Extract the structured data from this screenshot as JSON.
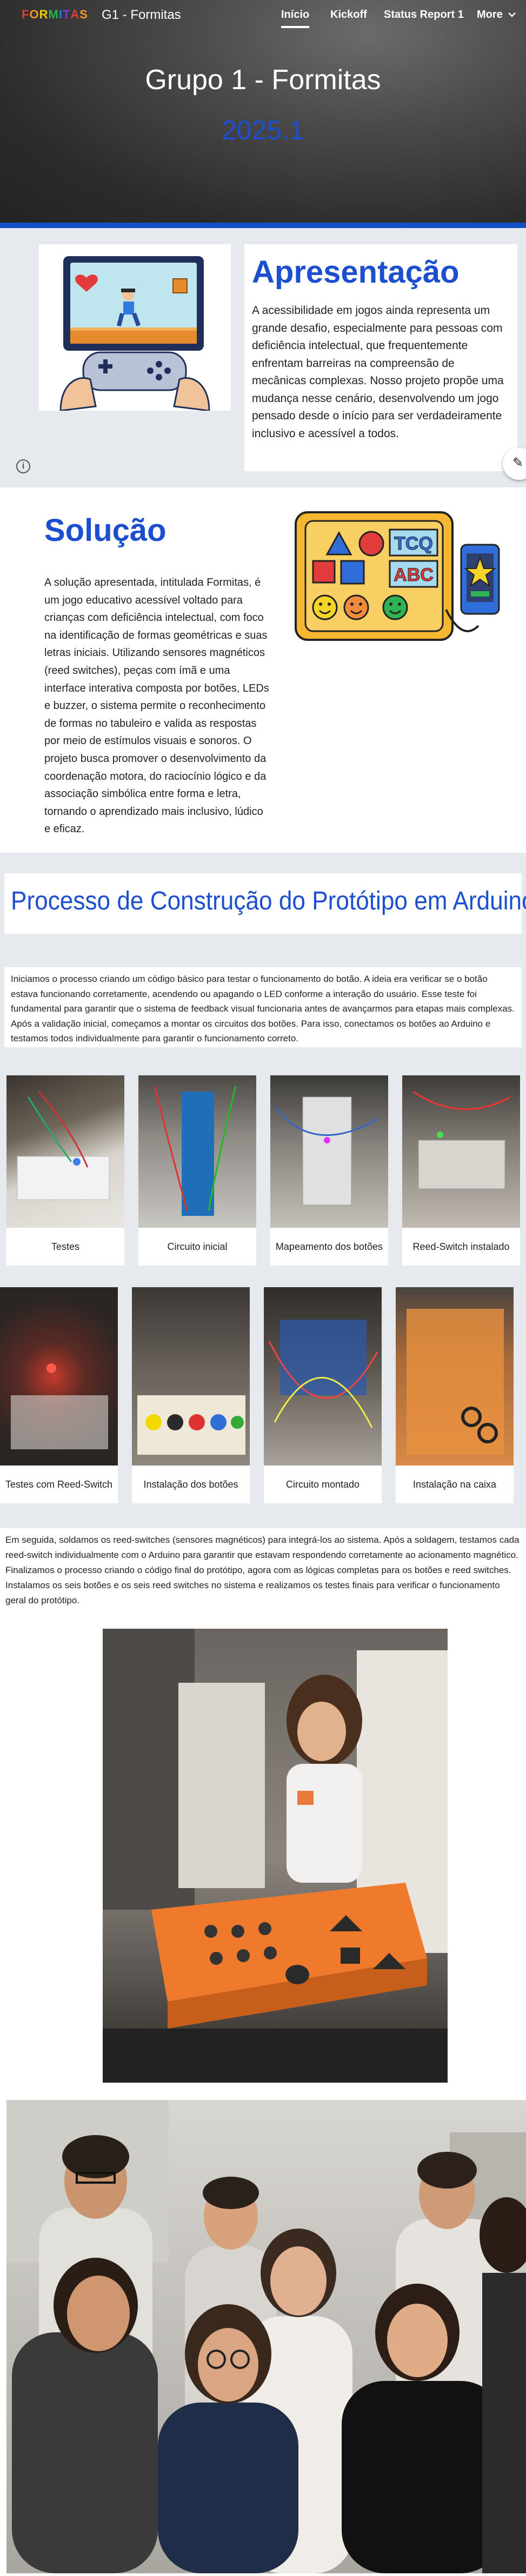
{
  "header": {
    "logo_letters": [
      "F",
      "O",
      "R",
      "M",
      "I",
      "T",
      "A",
      "S"
    ],
    "logo_colors": [
      "#e23b3b",
      "#f39a1e",
      "#f5c800",
      "#2fae4e",
      "#1c7fe0",
      "#7a3fd1",
      "#e23b3b",
      "#f39a1e"
    ],
    "site_name": "G1 - Formitas",
    "nav": [
      {
        "label": "Início",
        "active": true
      },
      {
        "label": "Kickoff",
        "active": false
      },
      {
        "label": "Status Report 1",
        "active": false
      },
      {
        "label": "More",
        "active": false
      }
    ],
    "more_icon": "chevron-down-icon"
  },
  "hero": {
    "title": "Grupo 1 - Formitas",
    "subtitle": "2025.1"
  },
  "apresentacao": {
    "title": "Apresentação",
    "text": "A acessibilidade em jogos ainda representa um grande desafio, especialmente para pessoas com deficiência intelectual, que frequentemente enfrentam barreiras na compreensão de mecânicas complexas. Nosso projeto propõe uma mudança nesse cenário, desenvolvendo um jogo pensado desde o início para ser verdadeiramente inclusivo e acessível a todos.",
    "illustration_icon": "game-controller-illustration",
    "info_icon": "info-icon",
    "edit_icon": "pencil-icon"
  },
  "solucao": {
    "title": "Solução",
    "text": "A solução apresentada, intitulada Formitas, é um jogo educativo acessível voltado para crianças com deficiência intelectual, com foco na identificação de formas geométricas e suas letras iniciais. Utilizando sensores magnéticos (reed switches), peças com ímã e uma interface interativa composta por botões, LEDs e buzzer, o sistema permite o reconhecimento de formas no tabuleiro e valida as respostas por meio de estímulos visuais e sonoros. O projeto busca promover o desenvolvimento da coordenação motora, do raciocínio lógico e da associação simbólica entre forma e letra, tornando o aprendizado mais inclusivo, lúdico e eficaz.",
    "board_letters": {
      "row1": "TCQ",
      "row2": "ABC"
    },
    "illustration_icon": "shape-board-illustration"
  },
  "arduino": {
    "title": "Processo de Construção do Protótipo em Arduino",
    "intro": "Iniciamos o processo criando um código básico para testar o funcionamento do botão. A ideia era verificar se o botão estava funcionando corretamente, acendendo ou apagando o LED conforme a interação do usuário. Esse teste foi fundamental para garantir que o sistema de feedback visual funcionaria antes de avançarmos para etapas mais complexas. Após a validação inicial, começamos a montar os circuitos dos botões. Para isso, conectamos os botões ao Arduino e testamos todos individualmente para garantir o funcionamento correto.",
    "photos_row1": [
      {
        "caption": "Testes"
      },
      {
        "caption": "Circuito inicial"
      },
      {
        "caption": "Mapeamento dos botões"
      },
      {
        "caption": "Reed-Switch instalado"
      }
    ],
    "photos_row2": [
      {
        "caption": "Testes com Reed-Switch"
      },
      {
        "caption": "Instalação dos botões"
      },
      {
        "caption": "Circuito montado"
      },
      {
        "caption": "Instalação na caixa"
      }
    ],
    "followup": "Em seguida, soldamos os reed-switches (sensores magnéticos) para integrá-los ao sistema. Após a soldagem, testamos cada reed-switch individualmente com o Arduino para garantir que estavam respondendo corretamente ao acionamento magnético. Finalizamos o processo criando o código final do protótipo, agora com as lógicas completas para os botões e reed switches. Instalamos os seis botões e os seis reed switches no sistema e realizamos os testes finais para verificar o funcionamento geral do protótipo."
  },
  "colors": {
    "accent_blue": "#1c4fd0",
    "section_gray": "#e6e9ee",
    "box_orange": "#ef7a2b"
  }
}
